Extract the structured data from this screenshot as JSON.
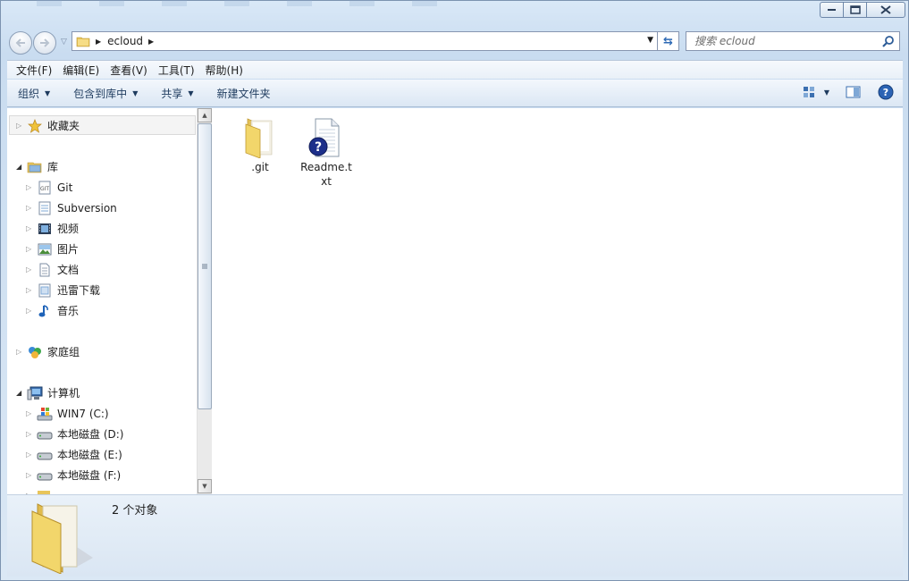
{
  "window": {
    "caption_buttons": [
      "minimize",
      "maximize",
      "close"
    ]
  },
  "address_bar": {
    "path": [
      "ecloud"
    ],
    "refresh_icon": "refresh-icon"
  },
  "search": {
    "placeholder": "搜索 ecloud"
  },
  "menu": {
    "items": [
      "文件(F)",
      "编辑(E)",
      "查看(V)",
      "工具(T)",
      "帮助(H)"
    ]
  },
  "toolbar": {
    "organize": "组织",
    "include_in_library": "包含到库中",
    "share": "共享",
    "new_folder": "新建文件夹"
  },
  "nav_pane": {
    "favorites": "收藏夹",
    "libraries": {
      "label": "库",
      "items": [
        "Git",
        "Subversion",
        "视频",
        "图片",
        "文档",
        "迅雷下载",
        "音乐"
      ]
    },
    "homegroup": "家庭组",
    "computer": {
      "label": "计算机",
      "items": [
        "WIN7 (C:)",
        "本地磁盘 (D:)",
        "本地磁盘 (E:)",
        "本地磁盘 (F:)"
      ]
    }
  },
  "files": [
    {
      "name": ".git",
      "type": "folder"
    },
    {
      "name": "Readme.txt",
      "type": "unknown-file"
    }
  ],
  "details": {
    "count": "2 个对象"
  },
  "colors": {
    "frame": "#c9dcf0",
    "accent": "#2e6ab5",
    "folder": "#f2d66b"
  }
}
